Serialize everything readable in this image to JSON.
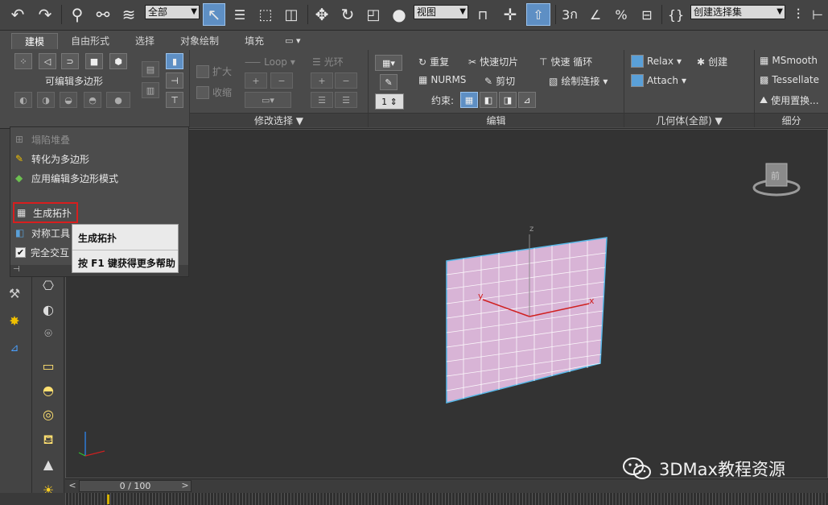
{
  "toolbar": {
    "selection_filter": "全部",
    "ref_coord": "视图",
    "named_selection": "创建选择集",
    "snap_labels": {
      "snap3": "3",
      "angle": "∠",
      "percent": "%",
      "spinner": "⊟"
    }
  },
  "ribbon": {
    "tabs": [
      "建模",
      "自由形式",
      "选择",
      "对象绘制",
      "填充"
    ],
    "active_tab": "建模",
    "pin_label": "▭ ▾",
    "polygon_modeling": {
      "label": "可编辑多边形"
    },
    "modify_selection": {
      "grow": "扩大",
      "shrink": "收缩",
      "loop": "Loop",
      "ring": "光环",
      "footer": "修改选择 ▼"
    },
    "edit": {
      "repeat": "重复",
      "quickslice": "快速切片",
      "swiftloop": "快速 循环",
      "nurms": "NURMS",
      "cut": "剪切",
      "paintconnect": "绘制连接",
      "constraints_label": "约束:",
      "spinner_value": "1",
      "footer": "编辑"
    },
    "geometry": {
      "relax": "Relax",
      "create": "创建",
      "attach": "Attach",
      "footer": "几何体(全部) ▼"
    },
    "subdivision": {
      "msmooth": "MSmooth",
      "tessellate": "Tessellate",
      "use_displacement": "使用置换...",
      "footer": "细分"
    }
  },
  "menu": {
    "items": [
      {
        "label": "塌陷堆叠",
        "disabled": true
      },
      {
        "label": "转化为多边形",
        "disabled": false
      },
      {
        "label": "应用编辑多边形模式",
        "disabled": false
      },
      {
        "label": "生成拓扑",
        "disabled": false,
        "highlighted": true
      },
      {
        "label": "对称工具",
        "disabled": false
      },
      {
        "label": "完全交互",
        "disabled": false,
        "checked": true
      }
    ]
  },
  "tooltip": {
    "title": "生成拓扑",
    "help": "按 F1 键获得更多帮助"
  },
  "viewport": {
    "axis_z": "z",
    "axis_x": "x",
    "axis_y": "y",
    "viewcube_label": "前"
  },
  "timeline": {
    "frame": "0 / 100",
    "prev": "<",
    "next": ">"
  },
  "watermark": {
    "text": "3DMax教程资源"
  },
  "colors": {
    "accent": "#5e8fc4",
    "highlight_border": "#d81e1e",
    "plane_fill": "#d8b4d6",
    "plane_edge": "#58b8e8"
  }
}
